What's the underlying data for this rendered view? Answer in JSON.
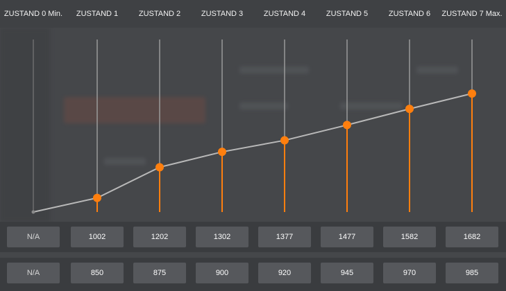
{
  "headers": [
    "ZUSTAND 0 Min.",
    "ZUSTAND 1",
    "ZUSTAND 2",
    "ZUSTAND 3",
    "ZUSTAND 4",
    "ZUSTAND 5",
    "ZUSTAND 6",
    "ZUSTAND 7 Max."
  ],
  "row1": [
    "N/A",
    "1002",
    "1202",
    "1302",
    "1377",
    "1477",
    "1582",
    "1682"
  ],
  "row2": [
    "N/A",
    "850",
    "875",
    "900",
    "920",
    "945",
    "970",
    "985"
  ],
  "chart_data": {
    "type": "line",
    "categories": [
      "ZUSTAND 0 Min.",
      "ZUSTAND 1",
      "ZUSTAND 2",
      "ZUSTAND 3",
      "ZUSTAND 4",
      "ZUSTAND 5",
      "ZUSTAND 6",
      "ZUSTAND 7 Max."
    ],
    "values": [
      null,
      1002,
      1202,
      1302,
      1377,
      1477,
      1582,
      1682
    ],
    "start_anchor": 0.0,
    "ylim": [
      0,
      2000
    ],
    "colors": {
      "line": "#b9b9b9",
      "marker": "#ff7f0e",
      "stem": "#ff7f0e",
      "guide": "#9a9a9a"
    }
  }
}
